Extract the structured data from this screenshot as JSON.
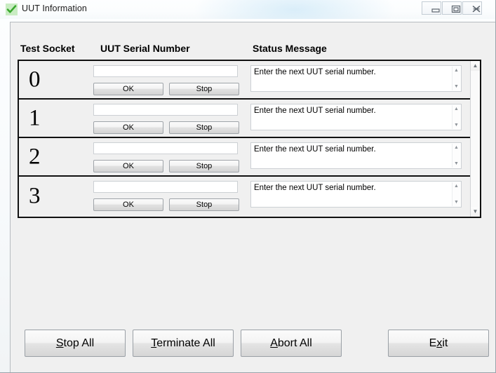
{
  "window": {
    "title": "UUT Information",
    "icon": "checkmark-icon",
    "controls": {
      "minimize": "minimize-icon",
      "maximize": "maximize-icon",
      "close": "close-icon"
    }
  },
  "headers": {
    "test_socket": "Test Socket",
    "uut_serial_number": "UUT Serial Number",
    "status_message": "Status Message"
  },
  "rows": [
    {
      "socket": "0",
      "serial_value": "",
      "serial_placeholder": "",
      "ok_label": "OK",
      "stop_label": "Stop",
      "status": "Enter the next UUT serial number."
    },
    {
      "socket": "1",
      "serial_value": "",
      "serial_placeholder": "",
      "ok_label": "OK",
      "stop_label": "Stop",
      "status": "Enter the next UUT serial number."
    },
    {
      "socket": "2",
      "serial_value": "",
      "serial_placeholder": "",
      "ok_label": "OK",
      "stop_label": "Stop",
      "status": "Enter the next UUT serial number."
    },
    {
      "socket": "3",
      "serial_value": "",
      "serial_placeholder": "",
      "ok_label": "OK",
      "stop_label": "Stop",
      "status": "Enter the next UUT serial number."
    }
  ],
  "footer": {
    "stop_all": {
      "pre": "",
      "accel": "S",
      "post": "top All"
    },
    "terminate_all": {
      "pre": "",
      "accel": "T",
      "post": "erminate All"
    },
    "abort_all": {
      "pre": "",
      "accel": "A",
      "post": "bort All"
    },
    "exit": {
      "pre": "E",
      "accel": "x",
      "post": "it"
    }
  },
  "colors": {
    "panel": "#f0f0f0",
    "icon_green": "#3aa82e",
    "icon_green_bg": "#c9ecc3",
    "row_border": "#111111",
    "button_face": "#e4e4e4"
  }
}
